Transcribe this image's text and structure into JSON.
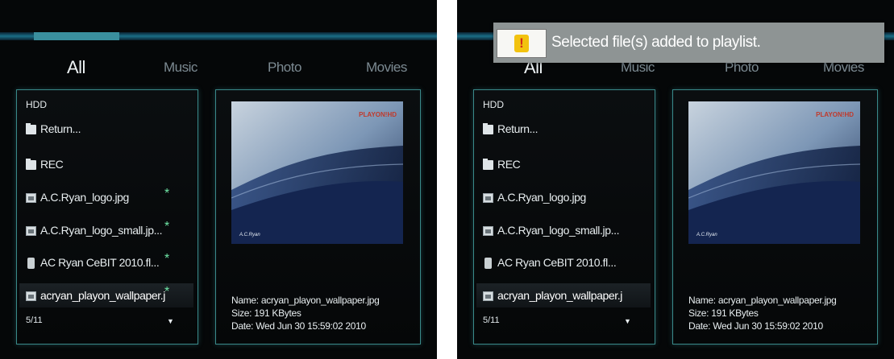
{
  "screens": [
    {
      "tabs": [
        "All",
        "Music",
        "Photo",
        "Movies"
      ],
      "active_tab": "All",
      "list": {
        "device": "HDD",
        "items": [
          {
            "label": "Return...",
            "icon": "folder-icon",
            "starred": false
          },
          {
            "label": "REC",
            "icon": "folder-icon",
            "starred": false
          },
          {
            "label": "A.C.Ryan_logo.jpg",
            "icon": "image-file-icon",
            "starred": true
          },
          {
            "label": "A.C.Ryan_logo_small.jp...",
            "icon": "image-file-icon",
            "starred": true
          },
          {
            "label": "AC Ryan CeBIT 2010.fl...",
            "icon": "video-file-icon",
            "starred": true
          },
          {
            "label": "acryan_playon_wallpaper.j",
            "icon": "image-file-icon",
            "starred": true,
            "selected": true
          }
        ],
        "star_symbol": "*",
        "page": "5/11",
        "scroll_indicator": "▼"
      },
      "preview": {
        "brand": "PLAYON!HD",
        "tagline": "A.C.Ryan",
        "name": "Name: acryan_playon_wallpaper.jpg",
        "size": "Size: 191 KBytes",
        "date": "Date: Wed Jun 30 15:59:02 2010"
      }
    },
    {
      "tabs": [
        "All",
        "Music",
        "Photo",
        "Movies"
      ],
      "active_tab": "All",
      "notification": {
        "message": "Selected file(s) added to playlist.",
        "icon": "warning-icon",
        "glyph": "!"
      },
      "list": {
        "device": "HDD",
        "items": [
          {
            "label": "Return...",
            "icon": "folder-icon",
            "starred": false
          },
          {
            "label": "REC",
            "icon": "folder-icon",
            "starred": false
          },
          {
            "label": "A.C.Ryan_logo.jpg",
            "icon": "image-file-icon",
            "starred": false
          },
          {
            "label": "A.C.Ryan_logo_small.jp...",
            "icon": "image-file-icon",
            "starred": false
          },
          {
            "label": "AC Ryan CeBIT 2010.fl...",
            "icon": "video-file-icon",
            "starred": false
          },
          {
            "label": "acryan_playon_wallpaper.j",
            "icon": "image-file-icon",
            "starred": false,
            "selected": true
          }
        ],
        "page": "5/11",
        "scroll_indicator": "▼"
      },
      "preview": {
        "brand": "PLAYON!HD",
        "tagline": "A.C.Ryan",
        "name": "Name: acryan_playon_wallpaper.jpg",
        "size": "Size: 191 KBytes",
        "date": "Date: Wed Jun 30 15:59:02 2010"
      }
    }
  ],
  "colors": {
    "accent": "#3a8f9e",
    "star": "#6fe6a6",
    "panel_border": "#3a8a8a",
    "toast": "#8e9494"
  }
}
